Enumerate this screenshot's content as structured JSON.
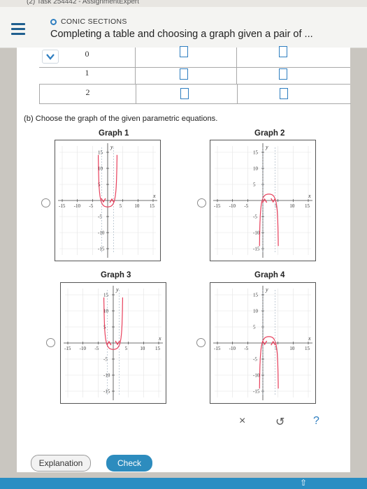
{
  "browser": {
    "tab_text": "(2) Task 254442 - AssignmentExpert"
  },
  "header": {
    "topic": "CONIC SECTIONS",
    "title": "Completing a table and choosing a graph given a pair of ..."
  },
  "table": {
    "rows": [
      {
        "t": "0"
      },
      {
        "t": "1"
      },
      {
        "t": "2"
      }
    ]
  },
  "part_b": {
    "prompt": "(b) Choose the graph of the given parametric equations."
  },
  "graphs": [
    {
      "title": "Graph 1",
      "selected": false
    },
    {
      "title": "Graph 2",
      "selected": false
    },
    {
      "title": "Graph 3",
      "selected": false
    },
    {
      "title": "Graph 4",
      "selected": false
    }
  ],
  "axes": {
    "x_label": "x",
    "y_label": "y",
    "x_ticks": [
      "-15",
      "-10",
      "-5",
      "5",
      "10",
      "15"
    ],
    "y_ticks": [
      "15",
      "10",
      "5",
      "-5",
      "-10",
      "-15"
    ],
    "range": [
      -15,
      15
    ]
  },
  "tools": {
    "clear_icon": "×",
    "undo_icon": "↺",
    "help_icon": "?"
  },
  "buttons": {
    "explanation": "Explanation",
    "check": "Check"
  },
  "colors": {
    "accent": "#2e7ec0",
    "curve": "#e8405c",
    "check_button": "#2d8cbe"
  }
}
